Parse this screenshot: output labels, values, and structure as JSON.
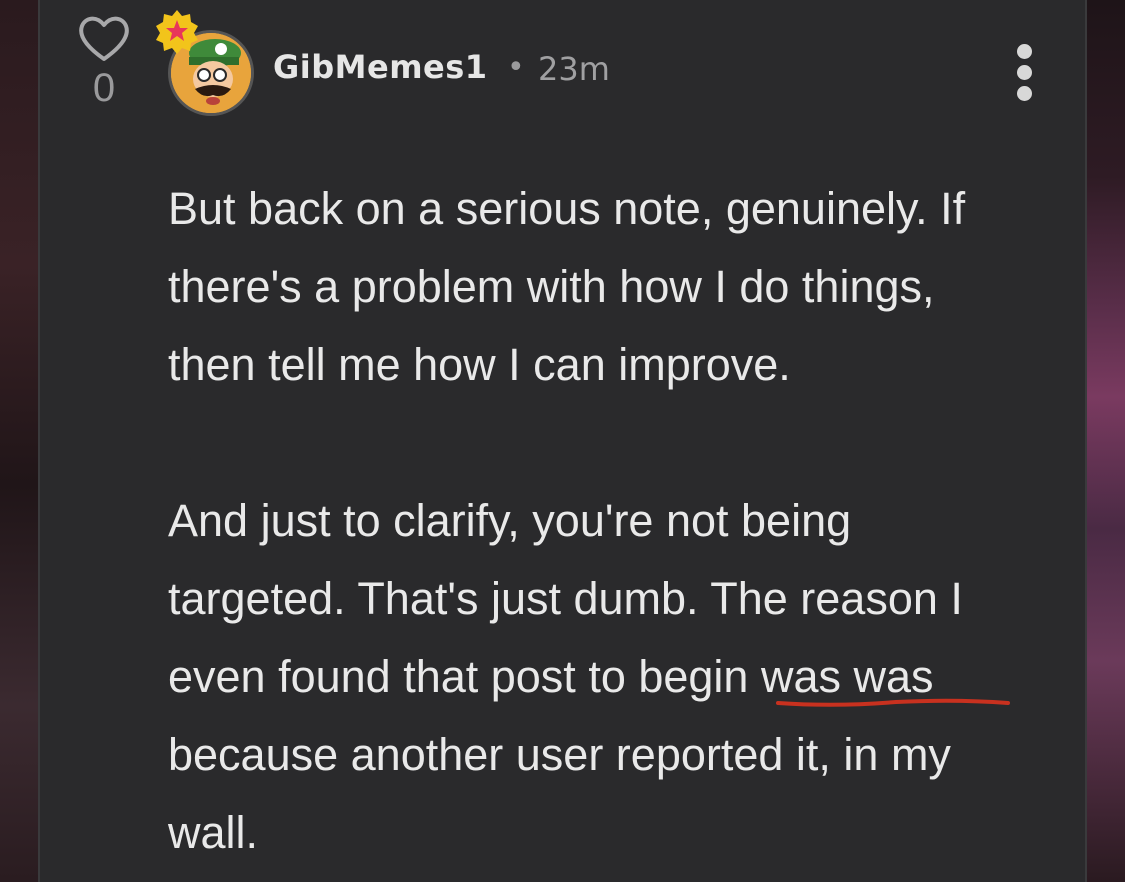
{
  "post": {
    "likes": "0",
    "username": "GibMemes1",
    "separator": "•",
    "time": "23m",
    "paragraphs": [
      {
        "lines": [
          "But back on a serious note, genuinely. If",
          "there's a problem with how I do things,",
          "then tell me how I can improve."
        ]
      },
      {
        "lines": [
          "And just to clarify, you're not being",
          "targeted. That's just dumb. The reason I",
          "even found that post to begin was was",
          "because another user reported it, in my",
          "wall."
        ]
      }
    ]
  },
  "icons": {
    "like": "heart-outline-icon",
    "badge": "star-badge-icon",
    "more": "vertical-ellipsis-icon"
  },
  "colors": {
    "card_background": "#2a2a2c",
    "text": "#e9e9e9",
    "muted": "#9a9a9c",
    "underline_annotation": "#c8311f",
    "badge_yellow": "#f2c41b",
    "badge_star": "#e8365a"
  }
}
